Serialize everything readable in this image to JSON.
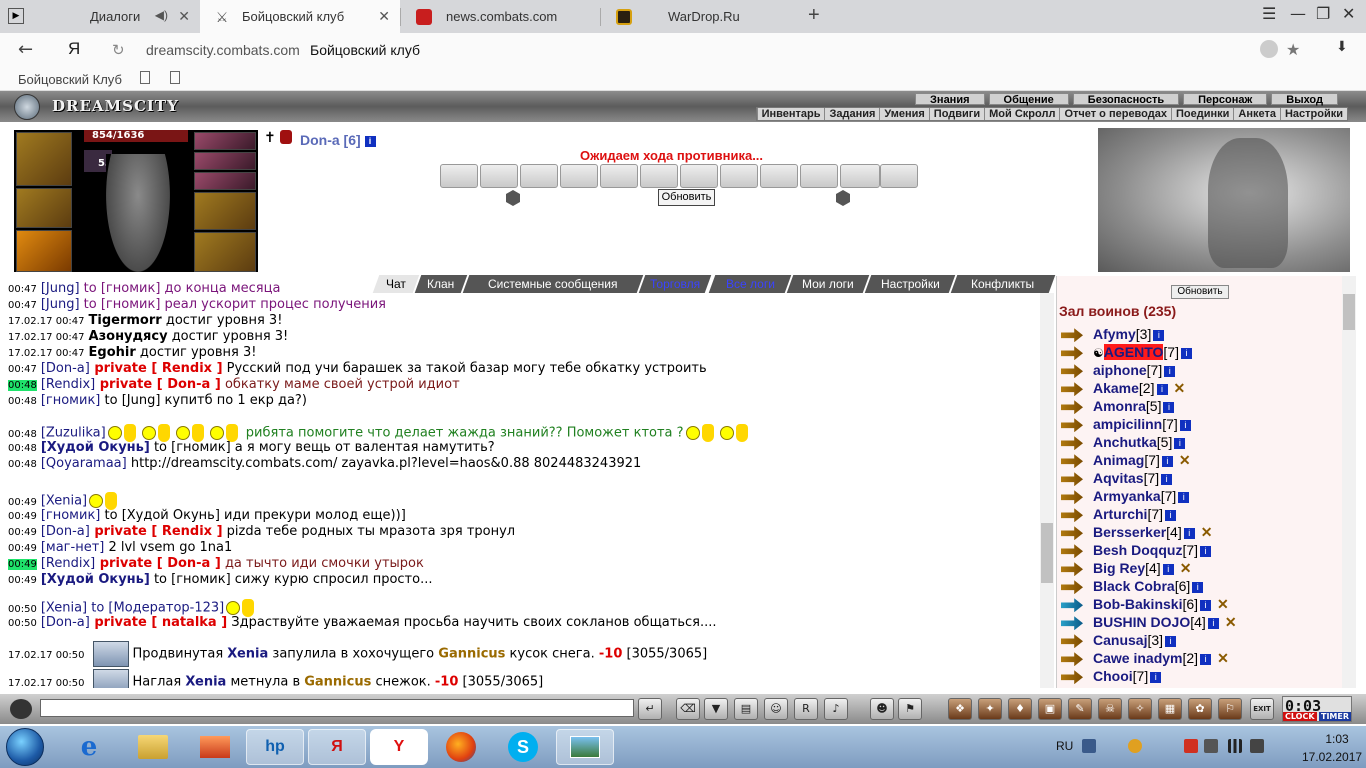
{
  "browser": {
    "tabs": [
      {
        "title": "Диалоги"
      },
      {
        "title": "Бойцовский клуб"
      },
      {
        "title": "news.combats.com"
      },
      {
        "title": "WarDrop.Ru"
      }
    ],
    "new_tab": "+",
    "url_host": "dreamscity.combats.com",
    "url_title": "Бойцовский клуб",
    "yandex_logo": "Я",
    "bookmark": "Бойцовский Клуб"
  },
  "game": {
    "logo": "DREAMSCITY",
    "menu_top": [
      "Знания",
      "Общение",
      "Безопасность",
      "Персонаж",
      "Выход"
    ],
    "menu_bottom": [
      "Инвентарь",
      "Задания",
      "Умения",
      "Подвиги",
      "Мой Скролл",
      "Отчет о переводах",
      "Поединки",
      "Анкета",
      "Настройки"
    ],
    "hp": "854/1636",
    "level_badge": "53",
    "opponent": "Don-a [6]",
    "waiting": "Ожидаем хода противника...",
    "refresh_btn": "Обновить"
  },
  "chat": {
    "tabs": [
      "Чат",
      "Клан",
      "Системные сообщения",
      "Торговля",
      "Все логи",
      "Мои логи",
      "Настройки",
      "Конфликты"
    ],
    "lines": [
      {
        "ts": "00:47",
        "parts": [
          [
            "nick",
            "[Jung]"
          ],
          [
            "purple",
            " to [гномик] до конца месяца"
          ]
        ]
      },
      {
        "ts": "00:47",
        "parts": [
          [
            "nick",
            "[Jung]"
          ],
          [
            "purple",
            " to [гномик] реал ускорит процес получения"
          ]
        ]
      },
      {
        "ts": "17.02.17 00:47",
        "parts": [
          [
            "nickb",
            "Tigermorr"
          ],
          [
            "plain",
            " достиг уровня 3!"
          ]
        ]
      },
      {
        "ts": "17.02.17 00:47",
        "parts": [
          [
            "nickb",
            "Азонудясу"
          ],
          [
            "plain",
            " достиг уровня 3!"
          ]
        ]
      },
      {
        "ts": "17.02.17 00:47",
        "parts": [
          [
            "nickb",
            "Egohir"
          ],
          [
            "plain",
            " достиг уровня 3!"
          ]
        ]
      },
      {
        "ts": "00:47",
        "parts": [
          [
            "nick",
            "[Don-a]"
          ],
          [
            "priv",
            " private [ Rendix ]"
          ],
          [
            "plain",
            " Русский под учи барашек за такой базар могу тебе обкатку устроить"
          ]
        ]
      },
      {
        "ts": "00:48",
        "hl": true,
        "parts": [
          [
            "nick",
            "[Rendix]"
          ],
          [
            "priv",
            " private [ Don-a ]"
          ],
          [
            "brown",
            " обкатку маме своей устрой идиот"
          ]
        ]
      },
      {
        "ts": "00:48",
        "parts": [
          [
            "nick",
            "[гномик]"
          ],
          [
            "plain",
            " to [Jung] купитб по 1 екр да?)"
          ]
        ]
      },
      {
        "ts": "00:48",
        "parts": [
          [
            "nick",
            "[Zuzulika]"
          ],
          [
            "smiles",
            "4"
          ],
          [
            "green",
            " рибята помогите что делает жажда знаний?? Поможет ктота ?"
          ],
          [
            "smiles",
            "2"
          ]
        ]
      },
      {
        "ts": "00:48",
        "parts": [
          [
            "nickbl",
            "[Худой Окунь]"
          ],
          [
            "plain",
            " to [гномик] а я могу вещь от валентая намутить?"
          ]
        ]
      },
      {
        "ts": "00:48",
        "parts": [
          [
            "nick",
            "[Qoyaramaa]"
          ],
          [
            "plain",
            " http://dreamscity.combats.com/ zayavka.pl?level=haos&0.88 8024483243921"
          ]
        ]
      },
      {
        "ts": "00:49",
        "parts": [
          [
            "nick",
            "[Xenia]"
          ],
          [
            "smiles",
            "1"
          ]
        ]
      },
      {
        "ts": "00:49",
        "parts": [
          [
            "nick",
            "[гномик]"
          ],
          [
            "plain",
            " to [Худой Окунь] иди прекури молод еще))]"
          ]
        ]
      },
      {
        "ts": "00:49",
        "parts": [
          [
            "nick",
            "[Don-a]"
          ],
          [
            "priv",
            " private [ Rendix ]"
          ],
          [
            "plain",
            " pizda тебе родных ты мразота зря тронул"
          ]
        ]
      },
      {
        "ts": "00:49",
        "parts": [
          [
            "nick",
            "[маг-нет]"
          ],
          [
            "plain",
            " 2 lvl vsem go 1na1"
          ]
        ]
      },
      {
        "ts": "00:49",
        "hl": true,
        "parts": [
          [
            "nick",
            "[Rendix]"
          ],
          [
            "priv",
            " private [ Don-a ]"
          ],
          [
            "brown",
            " да тычто иди смочки утырок"
          ]
        ]
      },
      {
        "ts": "00:49",
        "parts": [
          [
            "nickbl",
            "[Худой Окунь]"
          ],
          [
            "plain",
            " to [гномик] сижу курю спросил просто..."
          ]
        ]
      },
      {
        "ts": "00:50",
        "parts": [
          [
            "nick",
            "[Xenia]"
          ],
          [
            "nick",
            " to [Модератор-123]"
          ],
          [
            "smiles",
            "1"
          ]
        ]
      },
      {
        "ts": "00:50",
        "parts": [
          [
            "nick",
            "[Don-a]"
          ],
          [
            "priv",
            " private [ natalka ]"
          ],
          [
            "plain",
            " Здраствуйте уважаемая просьба научить своих сокланов общаться...."
          ]
        ]
      },
      {
        "ts": "17.02.17 00:50",
        "parts": [
          [
            "snow",
            ""
          ],
          [
            "plain",
            "Продвинутая "
          ],
          [
            "nickbl",
            "Xenia"
          ],
          [
            "plain",
            " запулила в хохочущего "
          ],
          [
            "gold",
            "Gannicus"
          ],
          [
            "plain",
            " кусок снега. "
          ],
          [
            "red",
            "-10"
          ],
          [
            "plain",
            " [3055/3065]"
          ]
        ]
      },
      {
        "ts": "17.02.17 00:50",
        "parts": [
          [
            "snow",
            ""
          ],
          [
            "plain",
            "Наглая "
          ],
          [
            "nickbl",
            "Xenia"
          ],
          [
            "plain",
            " метнула в "
          ],
          [
            "gold",
            "Gannicus"
          ],
          [
            "plain",
            " снежок. "
          ],
          [
            "red",
            "-10"
          ],
          [
            "plain",
            " [3055/3065]"
          ]
        ]
      }
    ]
  },
  "users": {
    "refresh": "Обновить",
    "hall": "Зал воинов (235)",
    "list": [
      {
        "name": "Afymy",
        "lvl": "[3]",
        "sword": false
      },
      {
        "name": "AGENTO",
        "lvl": "[7]",
        "sword": false,
        "special": true
      },
      {
        "name": "aiphone",
        "lvl": "[7]",
        "sword": false
      },
      {
        "name": "Akame",
        "lvl": "[2]",
        "sword": true
      },
      {
        "name": "Amonra",
        "lvl": "[5]",
        "sword": false
      },
      {
        "name": "ampicilinn",
        "lvl": "[7]",
        "sword": false
      },
      {
        "name": "Anchutka",
        "lvl": "[5]",
        "sword": false
      },
      {
        "name": "Animag",
        "lvl": "[7]",
        "sword": true
      },
      {
        "name": "Aqvitas",
        "lvl": "[7]",
        "sword": false
      },
      {
        "name": "Armyanka",
        "lvl": "[7]",
        "sword": false
      },
      {
        "name": "Arturchi",
        "lvl": "[7]",
        "sword": false
      },
      {
        "name": "Bersserker",
        "lvl": "[4]",
        "sword": true
      },
      {
        "name": "Besh Doqquz",
        "lvl": "[7]",
        "sword": false
      },
      {
        "name": "Big Rey",
        "lvl": "[4]",
        "sword": true
      },
      {
        "name": "Black Cobra",
        "lvl": "[6]",
        "sword": false
      },
      {
        "name": "Bob-Bakinski",
        "lvl": "[6]",
        "sword": true,
        "teal": true
      },
      {
        "name": "BUSHIN DOJO",
        "lvl": "[4]",
        "sword": true,
        "teal": true
      },
      {
        "name": "Canusaj",
        "lvl": "[3]",
        "sword": false
      },
      {
        "name": "Cawe inadym",
        "lvl": "[2]",
        "sword": true
      },
      {
        "name": "Chooi",
        "lvl": "[7]",
        "sword": false
      }
    ],
    "info_glyph": "i",
    "sword_glyph": "✕"
  },
  "gamebar": {
    "clock": "0:03",
    "clock_lbl": "CLOCK",
    "timer_lbl": "TIMER",
    "exit_lbl": "EXIT"
  },
  "taskbar": {
    "lang": "RU",
    "time": "1:03",
    "date": "17.02.2017",
    "yandex": "Я",
    "y_browser": "Y",
    "hp": "hp"
  },
  "colors": {
    "accent_nick": "#1a1a80",
    "private": "#dd0000",
    "timestamp_highlight": "#1fe36b",
    "hall_title": "#8a1a1a"
  }
}
